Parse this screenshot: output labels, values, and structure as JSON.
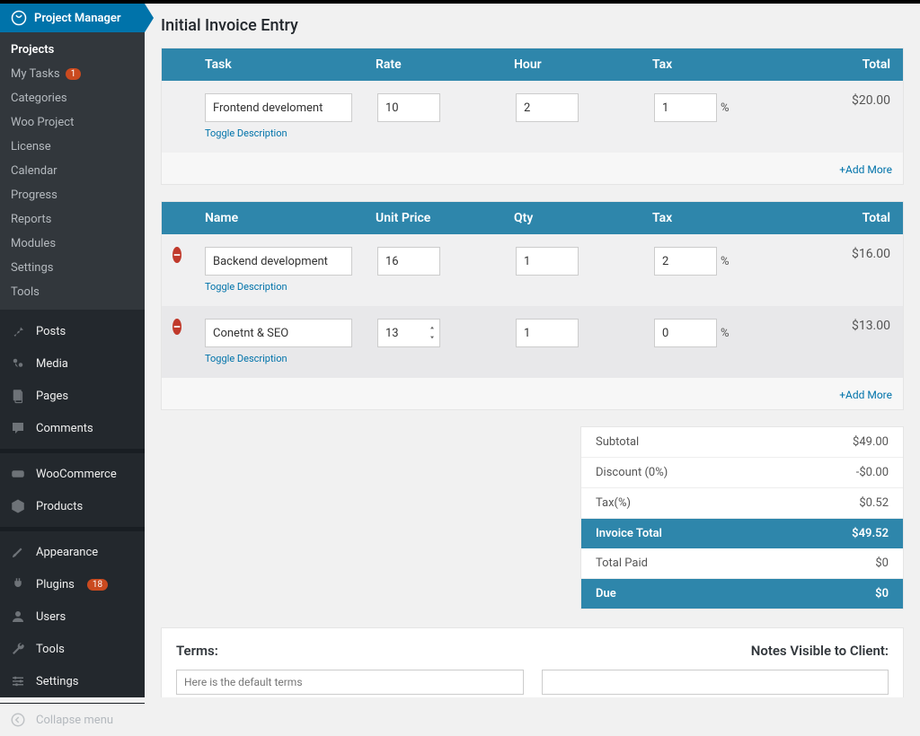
{
  "colors": {
    "accent": "#2e86ab",
    "sidebar_active": "#0073aa",
    "badge": "#ca4a1f"
  },
  "sidebar": {
    "pm_title": "Project Manager",
    "submenu": [
      {
        "label": "Projects",
        "active": true
      },
      {
        "label": "My Tasks",
        "badge": "1"
      },
      {
        "label": "Categories"
      },
      {
        "label": "Woo Project"
      },
      {
        "label": "License"
      },
      {
        "label": "Calendar"
      },
      {
        "label": "Progress"
      },
      {
        "label": "Reports"
      },
      {
        "label": "Modules"
      },
      {
        "label": "Settings"
      },
      {
        "label": "Tools"
      }
    ],
    "nav": [
      {
        "icon": "pin",
        "label": "Posts"
      },
      {
        "icon": "media",
        "label": "Media"
      },
      {
        "icon": "page",
        "label": "Pages"
      },
      {
        "icon": "comment",
        "label": "Comments"
      },
      {
        "sep": true
      },
      {
        "icon": "woo",
        "label": "WooCommerce"
      },
      {
        "icon": "product",
        "label": "Products"
      },
      {
        "sep": true
      },
      {
        "icon": "appearance",
        "label": "Appearance"
      },
      {
        "icon": "plugin",
        "label": "Plugins",
        "badge": "18"
      },
      {
        "icon": "users",
        "label": "Users"
      },
      {
        "icon": "tools",
        "label": "Tools"
      },
      {
        "icon": "settings",
        "label": "Settings"
      }
    ],
    "collapse_label": "Collapse menu"
  },
  "page": {
    "title": "Initial Invoice Entry"
  },
  "table1": {
    "headers": {
      "task": "Task",
      "rate": "Rate",
      "hour": "Hour",
      "tax": "Tax",
      "total": "Total"
    },
    "rows": [
      {
        "task": "Frontend develoment",
        "rate": "10",
        "hour": "2",
        "tax": "1",
        "total": "$20.00"
      }
    ],
    "toggle_label": "Toggle Description",
    "add_more": "+Add More"
  },
  "table2": {
    "headers": {
      "name": "Name",
      "unitprice": "Unit Price",
      "qty": "Qty",
      "tax": "Tax",
      "total": "Total"
    },
    "rows": [
      {
        "name": "Backend development",
        "unitprice": "16",
        "qty": "1",
        "tax": "2",
        "total": "$16.00",
        "spinner": false
      },
      {
        "name": "Conetnt & SEO",
        "unitprice": "13",
        "qty": "1",
        "tax": "0",
        "total": "$13.00",
        "spinner": true
      }
    ],
    "toggle_label": "Toggle Description",
    "add_more": "+Add More",
    "percent_symbol": "%"
  },
  "summary": {
    "subtotal_label": "Subtotal",
    "subtotal_val": "$49.00",
    "discount_label": "Discount (0%)",
    "discount_val": "-$0.00",
    "tax_label": "Tax(%)",
    "tax_val": "$0.52",
    "total_label": "Invoice Total",
    "total_val": "$49.52",
    "paid_label": "Total Paid",
    "paid_val": "$0",
    "due_label": "Due",
    "due_val": "$0"
  },
  "footer": {
    "terms_heading": "Terms:",
    "terms_placeholder": "Here is the default terms",
    "notes_heading": "Notes Visible to Client:"
  }
}
